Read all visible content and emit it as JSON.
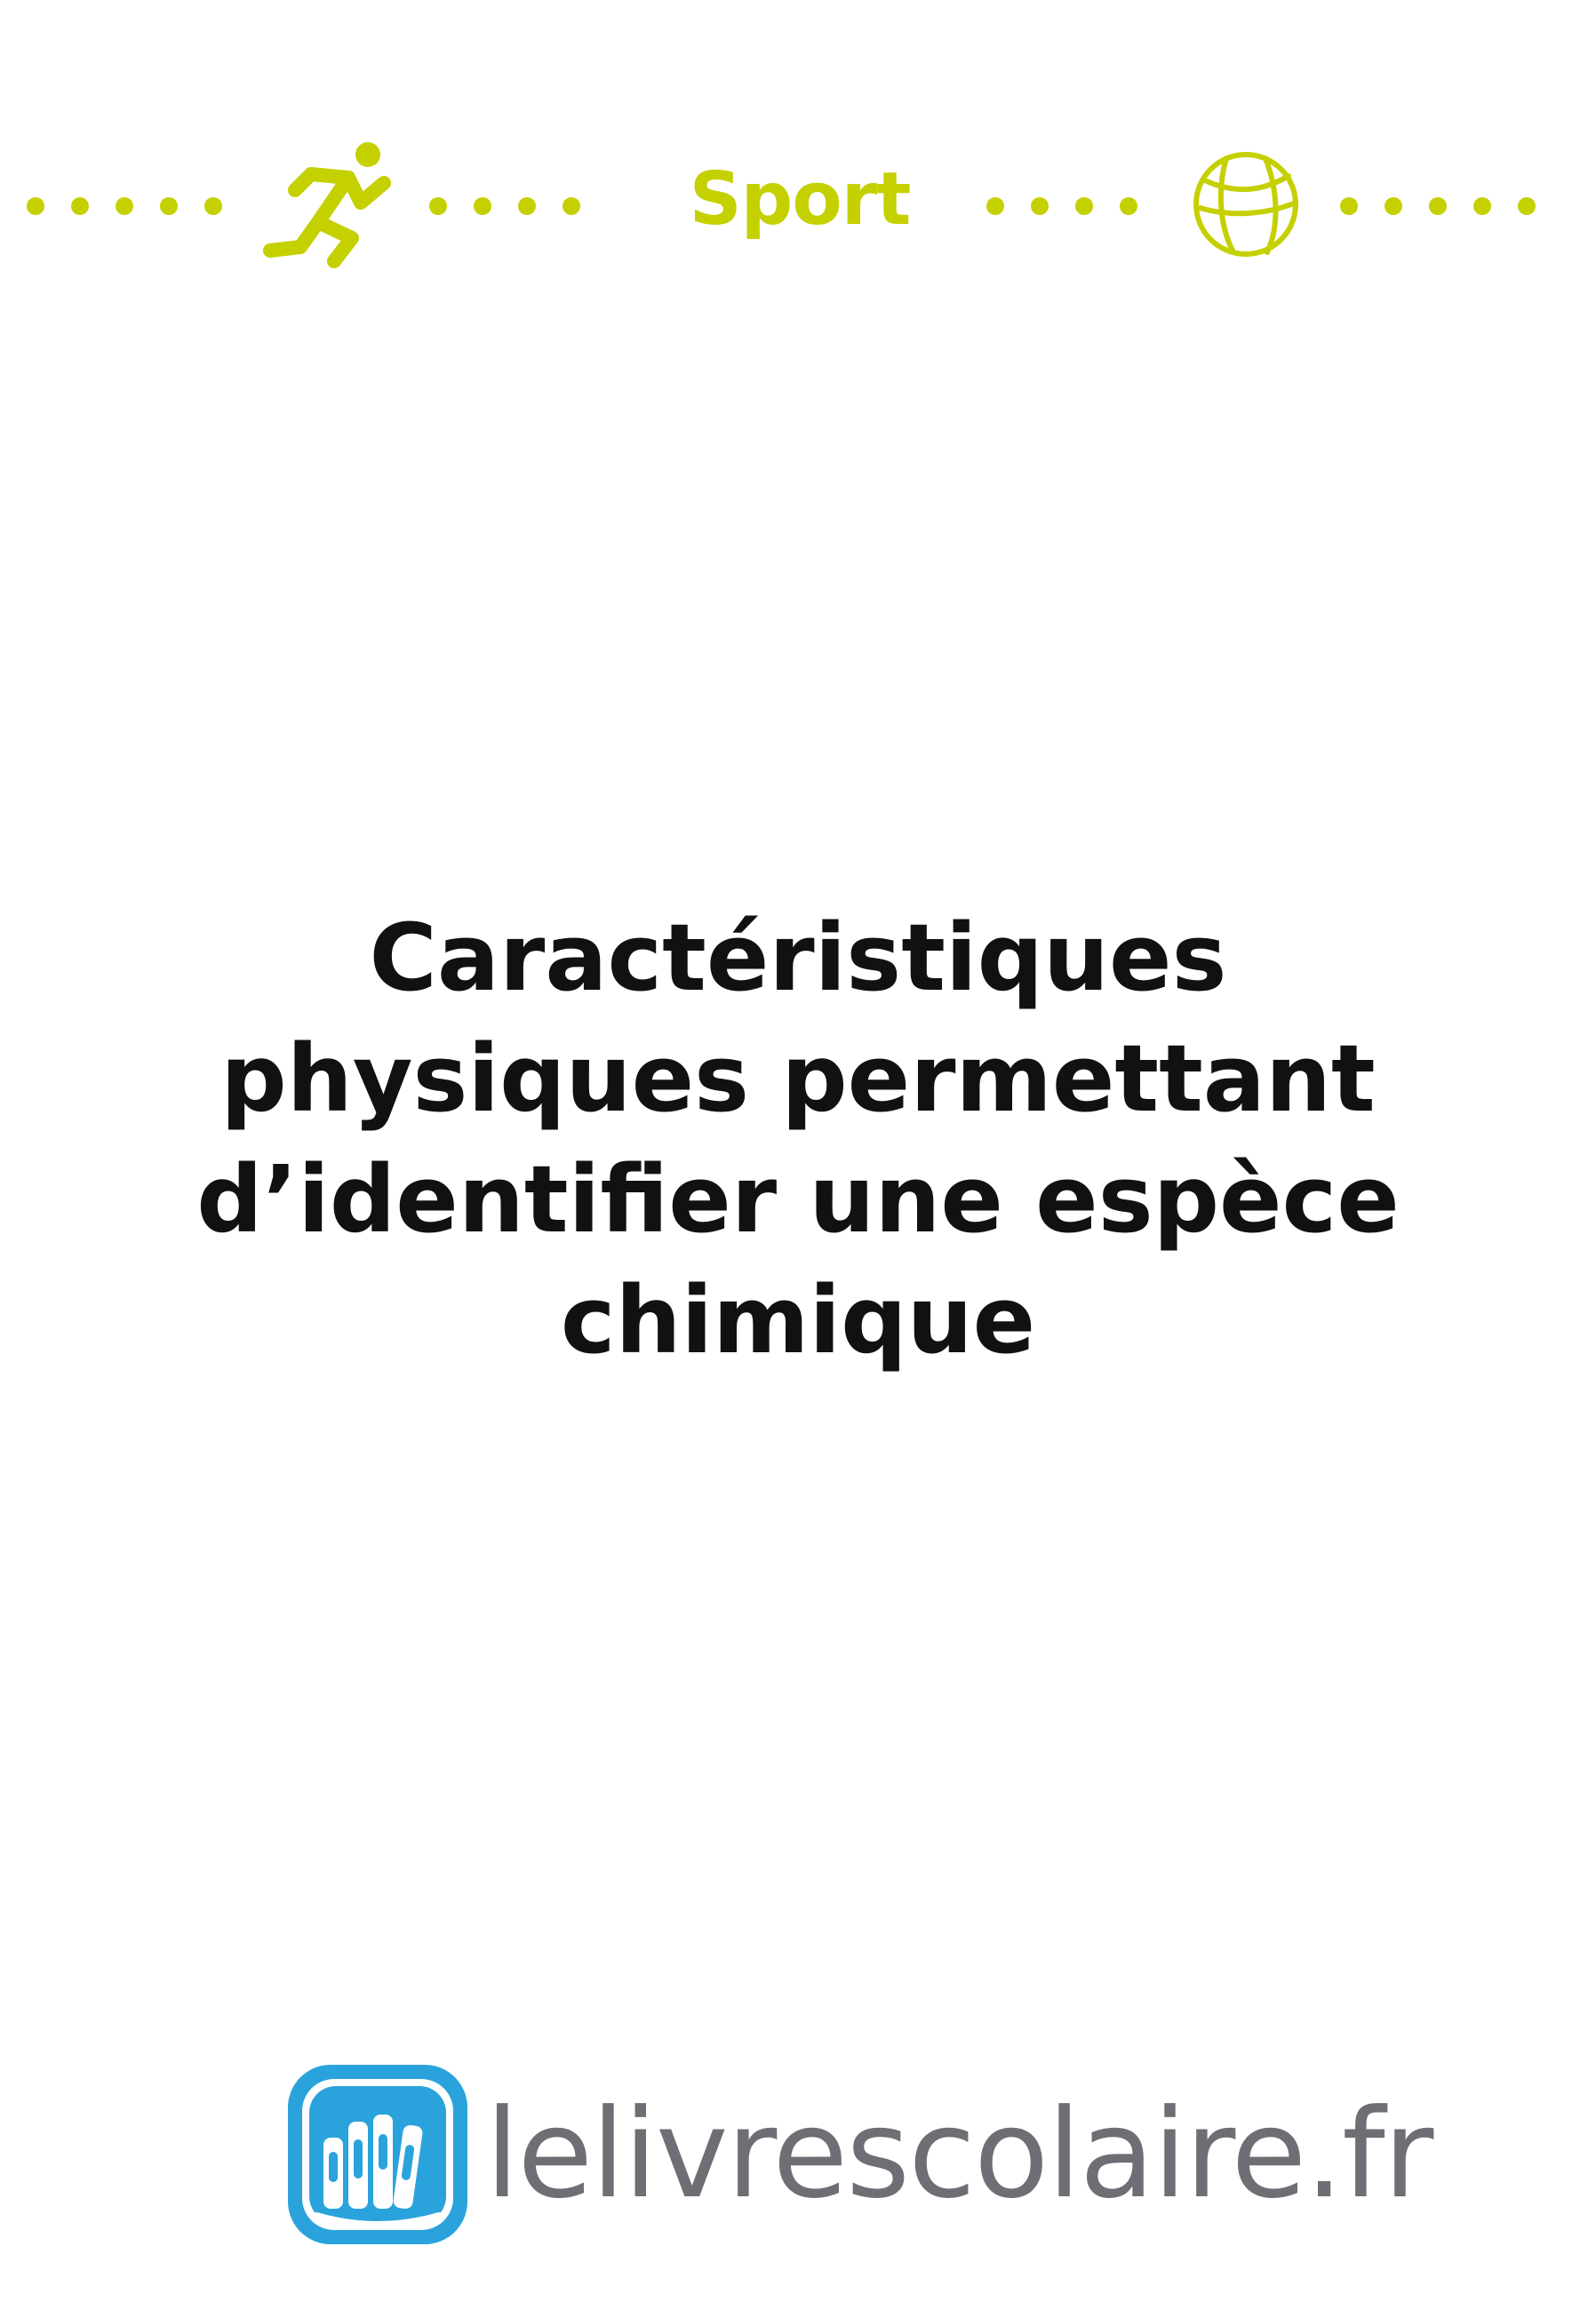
{
  "header": {
    "section_label": "Sport",
    "left_icon": "runner-icon",
    "right_icon": "basketball-icon",
    "accent_color": "#c5d000"
  },
  "main": {
    "title_lines": [
      "Caractéristiques",
      "physiques permettant",
      "d’identifier une espèce",
      "chimique"
    ]
  },
  "footer": {
    "logo_text": "lelivrescolaire.fr",
    "logo_icon": "books-logo-icon",
    "logo_color": "#2aa3dc",
    "logo_text_color": "#6e6e74"
  }
}
